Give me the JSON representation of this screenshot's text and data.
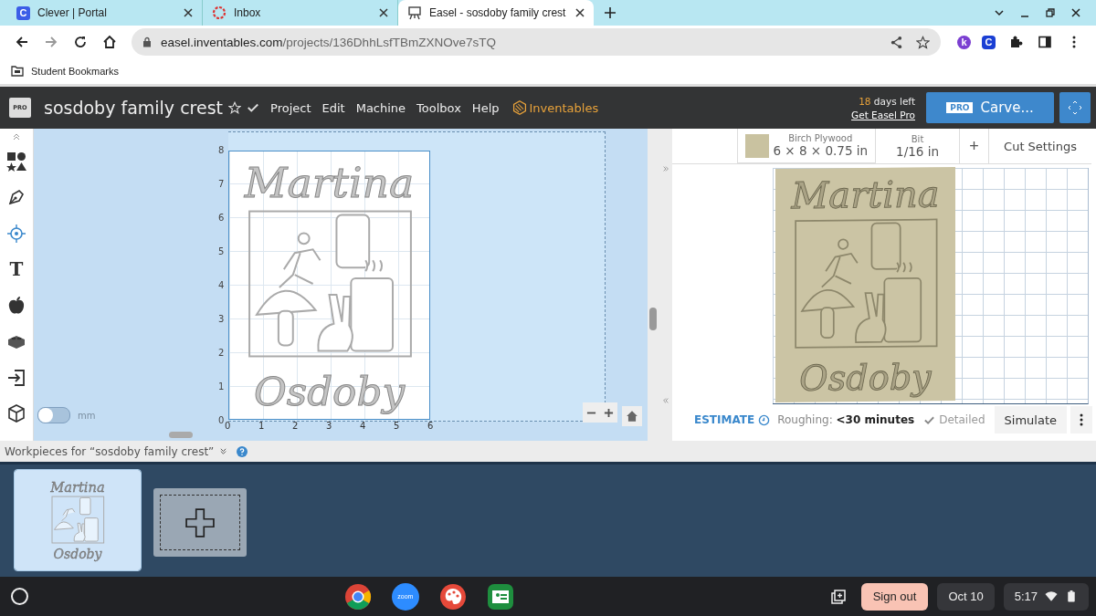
{
  "browser": {
    "tabs": [
      {
        "title": "Clever | Portal",
        "kind": "clever",
        "selected": false
      },
      {
        "title": "Inbox",
        "kind": "inbox",
        "selected": false
      },
      {
        "title": "Easel - sosdoby family crest",
        "kind": "easel",
        "selected": true
      }
    ],
    "clever_letter": "C",
    "url": {
      "host": "easel.inventables.com",
      "path": "/projects/136DhhLsfTBmZXNOve7sTQ"
    },
    "extensions": [
      {
        "letter": "k",
        "color": "#7b3fd1"
      },
      {
        "letter": "C",
        "color": "#1a3fd4"
      }
    ],
    "bookmarks": [
      {
        "label": "Student Bookmarks"
      }
    ]
  },
  "app": {
    "logo_badge": "PRO",
    "title": "sosdoby family crest",
    "menu": [
      "Project",
      "Edit",
      "Machine",
      "Toolbox",
      "Help"
    ],
    "brand": "Inventables",
    "trial_days": "18",
    "trial_rest": "days left",
    "upgrade_link": "Get Easel Pro",
    "carve_badge": "PRO",
    "carve_label": "Carve..."
  },
  "toolbar": [
    {
      "kind": "shapes"
    },
    {
      "kind": "pen"
    },
    {
      "kind": "target"
    },
    {
      "kind": "text",
      "glyph": "T"
    },
    {
      "kind": "apple"
    },
    {
      "kind": "brick"
    },
    {
      "kind": "import"
    },
    {
      "kind": "cube"
    }
  ],
  "canvas": {
    "y_ticks": [
      "8",
      "7",
      "6",
      "5",
      "4",
      "3",
      "2",
      "1",
      "0"
    ],
    "x_ticks": [
      "0",
      "1",
      "2",
      "3",
      "4",
      "5",
      "6"
    ],
    "unit_label": "mm",
    "metric": false,
    "design": {
      "top_text": "Martina",
      "bottom_text": "Osdoby"
    }
  },
  "preview": {
    "material": {
      "name": "Birch Plywood",
      "size": "6 × 8 × 0.75 in",
      "color": "#c9c2a0"
    },
    "bit_label": "Bit",
    "bit_value": "1/16 in",
    "add": "+",
    "cut_settings": "Cut Settings",
    "design": {
      "top_text": "Martina",
      "bottom_text": "Osdoby"
    },
    "estimate": {
      "label": "ESTIMATE",
      "roughing": "Roughing: **<30 minutes**",
      "detailed": "Detailed",
      "simulate": "Simulate"
    }
  },
  "workpieces": {
    "title": "Workpieces for “sosdoby family crest”",
    "items": [
      {
        "kind": "design",
        "selected": true,
        "top_text": "Martina",
        "bottom_text": "Osdoby"
      },
      {
        "kind": "add",
        "selected": false
      }
    ]
  },
  "taskbar": {
    "apps": [
      {
        "kind": "chrome"
      },
      {
        "kind": "zoom",
        "label": "zoom"
      },
      {
        "kind": "palette"
      },
      {
        "kind": "classroom"
      }
    ],
    "sign_out": "Sign out",
    "date": "Oct 10",
    "time": "5:17"
  }
}
